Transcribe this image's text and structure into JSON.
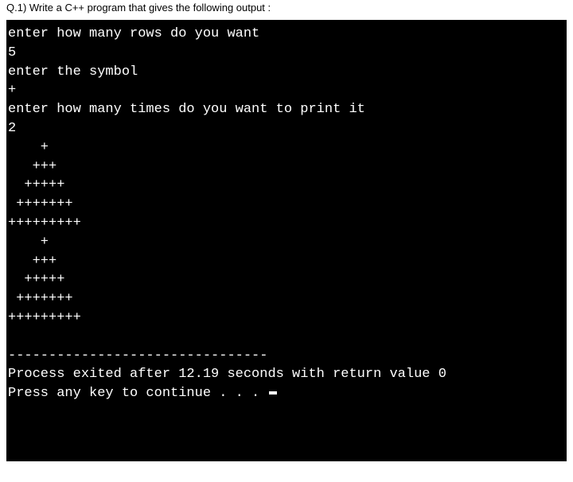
{
  "header": {
    "question": "Q.1) Write a C++ program that gives the following output :"
  },
  "console": {
    "prompt_rows": "enter how many rows do you want",
    "input_rows": "5",
    "prompt_symbol": "enter the symbol",
    "input_symbol": "+",
    "prompt_times": "enter how many times do you want to print it",
    "input_times": "2",
    "pattern": [
      "    +",
      "   +++",
      "  +++++",
      " +++++++",
      "+++++++++",
      "    +",
      "   +++",
      "  +++++",
      " +++++++",
      "+++++++++"
    ],
    "divider": "--------------------------------",
    "exit_msg": "Process exited after 12.19 seconds with return value 0",
    "continue_msg": "Press any key to continue . . . "
  }
}
